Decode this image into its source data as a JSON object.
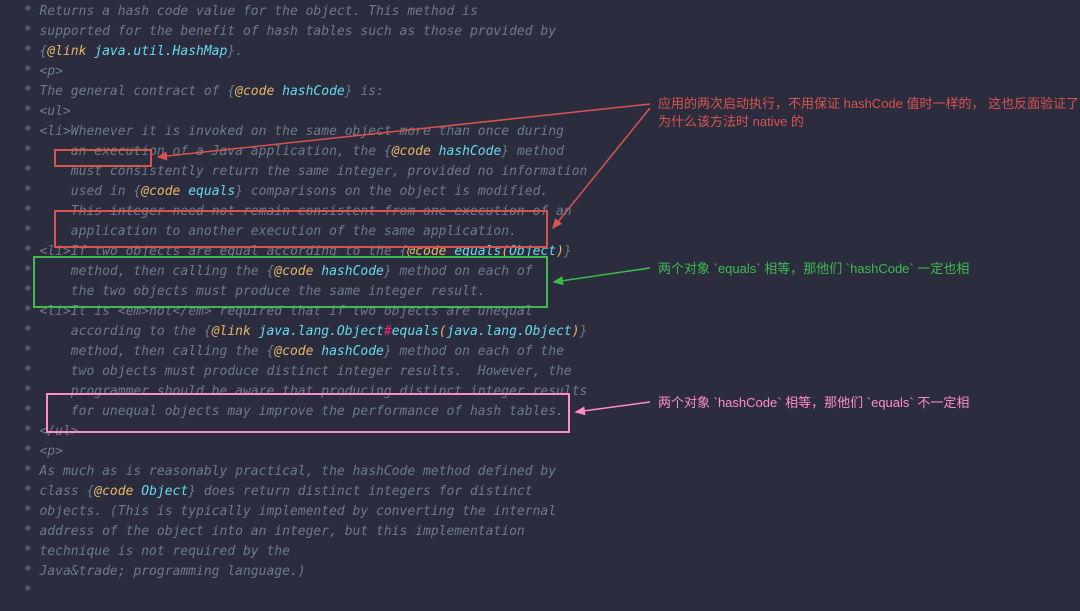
{
  "lines": [
    {
      "pre": " * ",
      "segs": [
        {
          "t": "Returns a hash code value for the object. This method is",
          "c": ""
        }
      ]
    },
    {
      "pre": " * ",
      "segs": [
        {
          "t": "supported for the benefit of hash tables such as those provided by",
          "c": ""
        }
      ]
    },
    {
      "pre": " * ",
      "segs": [
        {
          "t": "{",
          "c": "lbrace"
        },
        {
          "t": "@link",
          "c": "tag"
        },
        {
          "t": " ",
          "c": ""
        },
        {
          "t": "java.util.HashMap",
          "c": "type"
        },
        {
          "t": "}",
          "c": "lbrace"
        },
        {
          "t": ".",
          "c": ""
        }
      ]
    },
    {
      "pre": " * ",
      "segs": [
        {
          "t": "<p>",
          "c": ""
        }
      ]
    },
    {
      "pre": " * ",
      "segs": [
        {
          "t": "The general contract of ",
          "c": ""
        },
        {
          "t": "{",
          "c": "lbrace"
        },
        {
          "t": "@code",
          "c": "tag"
        },
        {
          "t": " ",
          "c": ""
        },
        {
          "t": "hashCode",
          "c": "type"
        },
        {
          "t": "}",
          "c": "lbrace"
        },
        {
          "t": " is:",
          "c": ""
        }
      ]
    },
    {
      "pre": " * ",
      "segs": [
        {
          "t": "<ul>",
          "c": ""
        }
      ]
    },
    {
      "pre": " * ",
      "segs": [
        {
          "t": "<li>Whenever it is invoked on the same object more than once during",
          "c": ""
        }
      ]
    },
    {
      "pre": " *     ",
      "segs": [
        {
          "t": "an execution of a Java application, the ",
          "c": ""
        },
        {
          "t": "{",
          "c": "lbrace"
        },
        {
          "t": "@code",
          "c": "tag"
        },
        {
          "t": " ",
          "c": ""
        },
        {
          "t": "hashCode",
          "c": "type"
        },
        {
          "t": "}",
          "c": "lbrace"
        },
        {
          "t": " method",
          "c": ""
        }
      ]
    },
    {
      "pre": " *     ",
      "segs": [
        {
          "t": "must consistently return the same integer, provided no information",
          "c": ""
        }
      ]
    },
    {
      "pre": " *     ",
      "segs": [
        {
          "t": "used in ",
          "c": ""
        },
        {
          "t": "{",
          "c": "lbrace"
        },
        {
          "t": "@code",
          "c": "tag"
        },
        {
          "t": " ",
          "c": ""
        },
        {
          "t": "equals",
          "c": "type"
        },
        {
          "t": "}",
          "c": "lbrace"
        },
        {
          "t": " comparisons on the object is modified.",
          "c": ""
        }
      ]
    },
    {
      "pre": " *     ",
      "segs": [
        {
          "t": "This integer need not remain consistent from one execution of an",
          "c": ""
        }
      ]
    },
    {
      "pre": " *     ",
      "segs": [
        {
          "t": "application to another execution of the same application.",
          "c": ""
        }
      ]
    },
    {
      "pre": " * ",
      "segs": [
        {
          "t": "<li>If two objects are equal according to the ",
          "c": ""
        },
        {
          "t": "{",
          "c": "lbrace"
        },
        {
          "t": "@code",
          "c": "tag"
        },
        {
          "t": " ",
          "c": ""
        },
        {
          "t": "equals",
          "c": "type"
        },
        {
          "t": "(",
          "c": "paren"
        },
        {
          "t": "Object",
          "c": "type"
        },
        {
          "t": ")",
          "c": "paren"
        },
        {
          "t": "}",
          "c": "lbrace"
        }
      ]
    },
    {
      "pre": " *     ",
      "segs": [
        {
          "t": "method, then calling the ",
          "c": ""
        },
        {
          "t": "{",
          "c": "lbrace"
        },
        {
          "t": "@code",
          "c": "tag"
        },
        {
          "t": " ",
          "c": ""
        },
        {
          "t": "hashCode",
          "c": "type"
        },
        {
          "t": "}",
          "c": "lbrace"
        },
        {
          "t": " method on each of",
          "c": ""
        }
      ]
    },
    {
      "pre": " *     ",
      "segs": [
        {
          "t": "the two objects must produce the same integer result.",
          "c": ""
        }
      ]
    },
    {
      "pre": " * ",
      "segs": [
        {
          "t": "<li>It is <em>not</em> required that if two objects are unequal",
          "c": ""
        }
      ]
    },
    {
      "pre": " *     ",
      "segs": [
        {
          "t": "according to the ",
          "c": ""
        },
        {
          "t": "{",
          "c": "lbrace"
        },
        {
          "t": "@link",
          "c": "tag"
        },
        {
          "t": " ",
          "c": ""
        },
        {
          "t": "java.lang.Object",
          "c": "type"
        },
        {
          "t": "#",
          "c": "kw"
        },
        {
          "t": "equals",
          "c": "type"
        },
        {
          "t": "(",
          "c": "paren"
        },
        {
          "t": "java.lang.Object",
          "c": "type"
        },
        {
          "t": ")",
          "c": "paren"
        },
        {
          "t": "}",
          "c": "lbrace"
        }
      ]
    },
    {
      "pre": " *     ",
      "segs": [
        {
          "t": "method, then calling the ",
          "c": ""
        },
        {
          "t": "{",
          "c": "lbrace"
        },
        {
          "t": "@code",
          "c": "tag"
        },
        {
          "t": " ",
          "c": ""
        },
        {
          "t": "hashCode",
          "c": "type"
        },
        {
          "t": "}",
          "c": "lbrace"
        },
        {
          "t": " method on each of the",
          "c": ""
        }
      ]
    },
    {
      "pre": " *     ",
      "segs": [
        {
          "t": "two objects must produce distinct integer results.  However, the",
          "c": ""
        }
      ]
    },
    {
      "pre": " *     ",
      "segs": [
        {
          "t": "programmer should be aware that producing distinct integer results",
          "c": ""
        }
      ]
    },
    {
      "pre": " *     ",
      "segs": [
        {
          "t": "for unequal objects may improve the performance of hash tables.",
          "c": ""
        }
      ]
    },
    {
      "pre": " * ",
      "segs": [
        {
          "t": "</ul>",
          "c": ""
        }
      ]
    },
    {
      "pre": " * ",
      "segs": [
        {
          "t": "<p>",
          "c": ""
        }
      ]
    },
    {
      "pre": " * ",
      "segs": [
        {
          "t": "As much as is reasonably practical, the hashCode method defined by",
          "c": ""
        }
      ]
    },
    {
      "pre": " * ",
      "segs": [
        {
          "t": "class ",
          "c": ""
        },
        {
          "t": "{",
          "c": "lbrace"
        },
        {
          "t": "@code",
          "c": "tag"
        },
        {
          "t": " ",
          "c": ""
        },
        {
          "t": "Object",
          "c": "type"
        },
        {
          "t": "}",
          "c": "lbrace"
        },
        {
          "t": " does return distinct integers for distinct",
          "c": ""
        }
      ]
    },
    {
      "pre": " * ",
      "segs": [
        {
          "t": "objects. (This is typically implemented by converting the internal",
          "c": ""
        }
      ]
    },
    {
      "pre": " * ",
      "segs": [
        {
          "t": "address of the object into an integer, but this implementation",
          "c": ""
        }
      ]
    },
    {
      "pre": " * ",
      "segs": [
        {
          "t": "technique is not required by the",
          "c": ""
        }
      ]
    },
    {
      "pre": " * ",
      "segs": [
        {
          "t": "Java&trade; programming language.)",
          "c": ""
        }
      ]
    },
    {
      "pre": " *",
      "segs": []
    }
  ],
  "annotations": {
    "red": "应用的两次启动执行，不用保证 hashCode 值时一样的，\n这也反面验证了为什么该方法时 native 的",
    "green": "两个对象 `equals` 相等，那他们 `hashCode` 一定也相",
    "pink": "两个对象 `hashCode` 相等，那他们 `equals` 不一定相"
  }
}
